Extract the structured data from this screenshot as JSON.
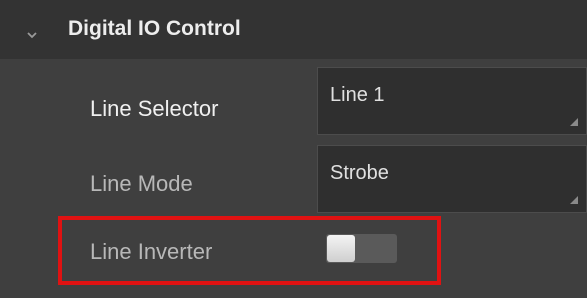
{
  "section": {
    "title": "Digital IO Control",
    "expand_icon": "chevron-down-icon"
  },
  "rows": [
    {
      "label": "Line Selector",
      "value": "Line 1"
    },
    {
      "label": "Line Mode",
      "value": "Strobe"
    },
    {
      "label": "Line Inverter",
      "toggle_on": false
    }
  ],
  "colors": {
    "background": "#3f3f3f",
    "header_background": "#333333",
    "highlight_border": "#e01212"
  }
}
